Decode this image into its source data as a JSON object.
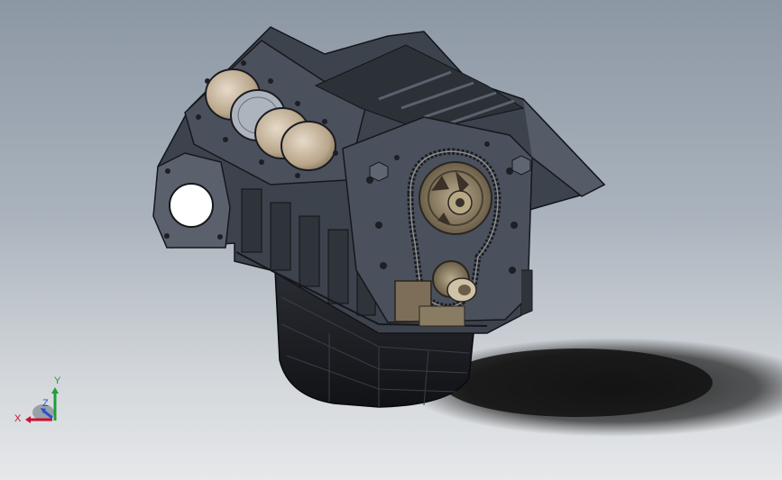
{
  "viewport": {
    "background_top": "#8c97a4",
    "background_bottom": "#e6e8ea"
  },
  "model": {
    "body_color": "#3d434d",
    "bore_color": "#c8b8a0",
    "oil_pan_color": "#1c1e22",
    "sprocket_color": "#8a7c62"
  },
  "triad": {
    "x_label": "X",
    "y_label": "Y",
    "z_label": "Z",
    "x_color": "#c8102e",
    "y_color": "#1e9e3a",
    "z_color": "#2a4fd0"
  }
}
